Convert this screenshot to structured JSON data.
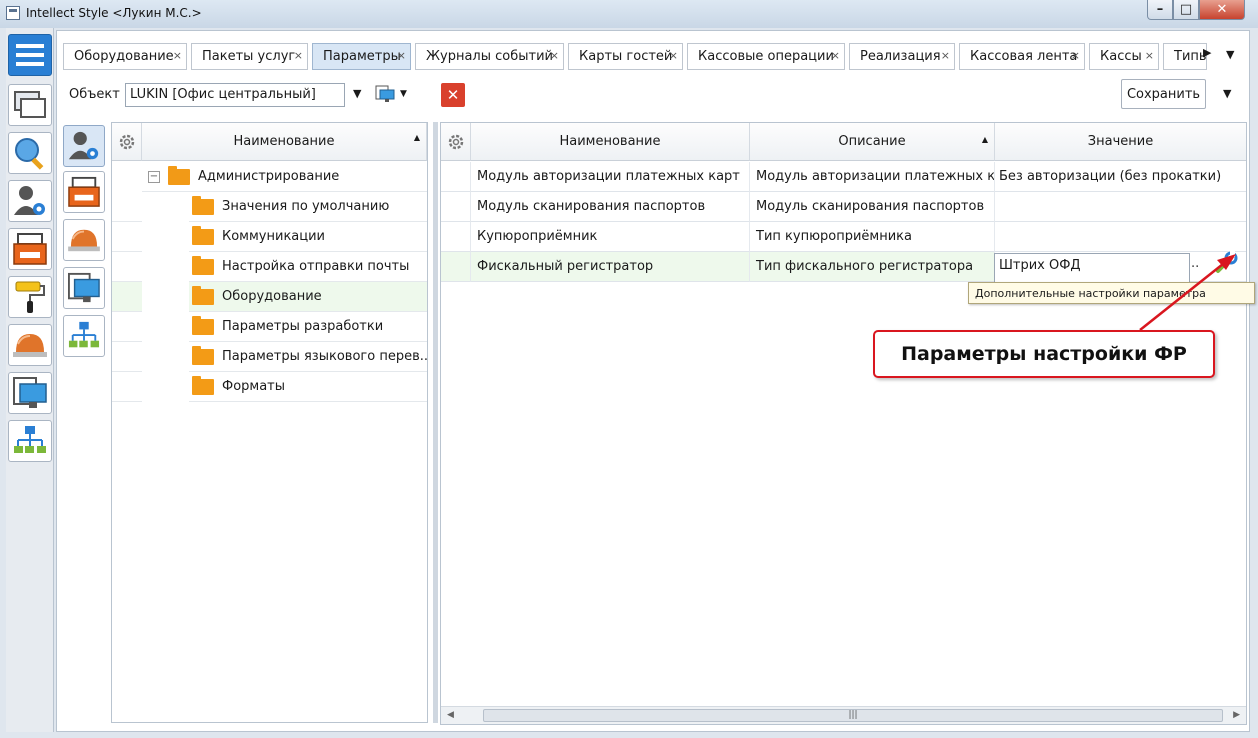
{
  "window": {
    "title": "Intellect Style  <Лукин М.С.>",
    "minimize_glyph": "–",
    "maximize_glyph": "□",
    "close_glyph": "✕"
  },
  "sidebar": {
    "items": [
      {
        "name": "menu-icon"
      },
      {
        "name": "windows-icon"
      },
      {
        "name": "search-icon"
      },
      {
        "name": "user-settings-icon"
      },
      {
        "name": "cash-register-icon"
      },
      {
        "name": "paint-roller-icon"
      },
      {
        "name": "service-bell-icon"
      },
      {
        "name": "monitor-icon"
      },
      {
        "name": "hierarchy-icon"
      }
    ]
  },
  "tabs": [
    {
      "label": "Оборудование",
      "close": "×",
      "active": false
    },
    {
      "label": "Пакеты услуг",
      "close": "×",
      "active": false
    },
    {
      "label": "Параметры",
      "close": "×",
      "active": true
    },
    {
      "label": "Журналы событий",
      "close": "×",
      "active": false
    },
    {
      "label": "Карты гостей",
      "close": "×",
      "active": false
    },
    {
      "label": "Кассовые операции",
      "close": "×",
      "active": false
    },
    {
      "label": "Реализация",
      "close": "×",
      "active": false
    },
    {
      "label": "Кассовая лента",
      "close": "×",
      "active": false
    },
    {
      "label": "Кассы",
      "close": "×",
      "active": false
    },
    {
      "label": "Типы",
      "close": "",
      "active": false
    }
  ],
  "toolbar": {
    "tab_scroll_glyph": "▶",
    "tab_menu_glyph": "▼",
    "object_label": "Объект",
    "object_value": "LUKIN [Офис центральный]",
    "dropdown_glyph": "▼",
    "small_dropdown_glyph": "▼",
    "clear_glyph": "✕",
    "save_label": "Сохранить",
    "save_menu_glyph": "▼"
  },
  "tree": {
    "header": "Наименование",
    "sort_glyph": "▲",
    "collapse_glyph": "−",
    "root": "Администрирование",
    "items": [
      {
        "label": "Значения по умолчанию",
        "selected": false
      },
      {
        "label": "Коммуникации",
        "selected": false
      },
      {
        "label": "Настройка отправки почты",
        "selected": false
      },
      {
        "label": "Оборудование",
        "selected": true
      },
      {
        "label": "Параметры разработки",
        "selected": false
      },
      {
        "label": "Параметры языкового перев...",
        "selected": false
      },
      {
        "label": "Форматы",
        "selected": false
      }
    ]
  },
  "grid": {
    "columns": {
      "name": "Наименование",
      "description": "Описание",
      "value": "Значение"
    },
    "sort_glyph": "▲",
    "rows": [
      {
        "name": "Модуль авторизации платежных карт",
        "description": "Модуль авторизации платежных к...",
        "value": "Без авторизации (без прокатки)"
      },
      {
        "name": "Модуль сканирования паспортов",
        "description": "Модуль сканирования паспортов",
        "value": ""
      },
      {
        "name": "Купюроприёмник",
        "description": "Тип купюроприёмника",
        "value": ""
      },
      {
        "name": "Фискальный регистратор",
        "description": "Тип фискального регистратора",
        "value": "Штрих ОФД"
      }
    ],
    "ellipsis": "..",
    "tooltip": "Дополнительные настройки параметра",
    "scroll_left": "◀",
    "scroll_right": "▶",
    "scroll_thumb": "|||"
  },
  "callout": {
    "text": "Параметры настройки ФР"
  },
  "colors": {
    "accent": "#2a7fd4",
    "selected_row": "#eef9ec",
    "folder": "#f39b16",
    "callout_border": "#d9161f",
    "clear_button": "#d9402c"
  }
}
